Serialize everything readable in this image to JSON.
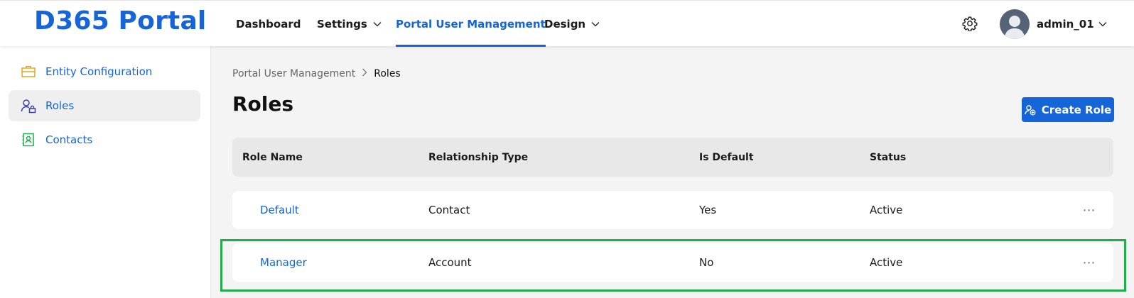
{
  "header": {
    "logo": "D365 Portal",
    "nav": [
      {
        "label": "Dashboard",
        "has_dropdown": false
      },
      {
        "label": "Settings",
        "has_dropdown": true
      },
      {
        "label": "Portal User Management",
        "has_dropdown": false,
        "active": true
      },
      {
        "label": "Design",
        "has_dropdown": true
      }
    ],
    "settings_icon": "gear-icon",
    "user": {
      "name": "admin_01",
      "avatar_icon": "user-avatar-icon"
    }
  },
  "sidebar": {
    "items": [
      {
        "label": "Entity Configuration",
        "icon": "briefcase-icon",
        "icon_color": "#e3a623"
      },
      {
        "label": "Roles",
        "icon": "user-lock-icon",
        "icon_color": "#3a3fa8",
        "active": true
      },
      {
        "label": "Contacts",
        "icon": "contact-card-icon",
        "icon_color": "#1fae4b"
      }
    ]
  },
  "breadcrumb": {
    "parent": "Portal User Management",
    "separator": ">",
    "current": "Roles"
  },
  "page": {
    "title": "Roles",
    "create_button": "Create Role"
  },
  "table": {
    "columns": [
      "Role Name",
      "Relationship Type",
      "Is Default",
      "Status"
    ],
    "rows": [
      {
        "role_name": "Default",
        "relationship_type": "Contact",
        "is_default": "Yes",
        "status": "Active",
        "actions": "⋯"
      },
      {
        "role_name": "Manager",
        "relationship_type": "Account",
        "is_default": "No",
        "status": "Active",
        "actions": "⋯",
        "highlighted": true
      }
    ]
  },
  "colors": {
    "accent": "#1565d8",
    "highlight": "#1fae4b"
  }
}
